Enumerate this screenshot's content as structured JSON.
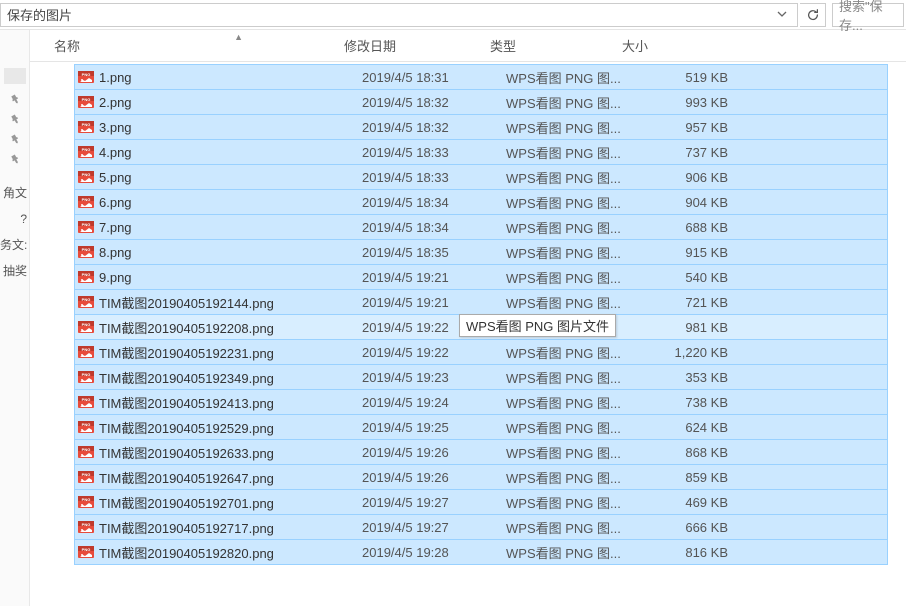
{
  "toolbar": {
    "path": "保存的图片",
    "search_placeholder": "搜索\"保存..."
  },
  "sidebar": {
    "items": [
      "角文",
      "?",
      "务文:",
      "抽奖"
    ]
  },
  "columns": {
    "name": "名称",
    "date": "修改日期",
    "type": "类型",
    "size": "大小"
  },
  "tooltip": "WPS看图 PNG 图片文件",
  "type_truncated": "WPS看图 PNG 图...",
  "files": [
    {
      "name": "1.png",
      "date": "2019/4/5 18:31",
      "size": "519 KB"
    },
    {
      "name": "2.png",
      "date": "2019/4/5 18:32",
      "size": "993 KB"
    },
    {
      "name": "3.png",
      "date": "2019/4/5 18:32",
      "size": "957 KB"
    },
    {
      "name": "4.png",
      "date": "2019/4/5 18:33",
      "size": "737 KB"
    },
    {
      "name": "5.png",
      "date": "2019/4/5 18:33",
      "size": "906 KB"
    },
    {
      "name": "6.png",
      "date": "2019/4/5 18:34",
      "size": "904 KB"
    },
    {
      "name": "7.png",
      "date": "2019/4/5 18:34",
      "size": "688 KB"
    },
    {
      "name": "8.png",
      "date": "2019/4/5 18:35",
      "size": "915 KB"
    },
    {
      "name": "9.png",
      "date": "2019/4/5 19:21",
      "size": "540 KB"
    },
    {
      "name": "TIM截图20190405192144.png",
      "date": "2019/4/5 19:21",
      "size": "721 KB"
    },
    {
      "name": "TIM截图20190405192208.png",
      "date": "2019/4/5 19:22",
      "size": "981 KB",
      "hover": true
    },
    {
      "name": "TIM截图20190405192231.png",
      "date": "2019/4/5 19:22",
      "size": "1,220 KB"
    },
    {
      "name": "TIM截图20190405192349.png",
      "date": "2019/4/5 19:23",
      "size": "353 KB"
    },
    {
      "name": "TIM截图20190405192413.png",
      "date": "2019/4/5 19:24",
      "size": "738 KB"
    },
    {
      "name": "TIM截图20190405192529.png",
      "date": "2019/4/5 19:25",
      "size": "624 KB"
    },
    {
      "name": "TIM截图20190405192633.png",
      "date": "2019/4/5 19:26",
      "size": "868 KB"
    },
    {
      "name": "TIM截图20190405192647.png",
      "date": "2019/4/5 19:26",
      "size": "859 KB"
    },
    {
      "name": "TIM截图20190405192701.png",
      "date": "2019/4/5 19:27",
      "size": "469 KB"
    },
    {
      "name": "TIM截图20190405192717.png",
      "date": "2019/4/5 19:27",
      "size": "666 KB"
    },
    {
      "name": "TIM截图20190405192820.png",
      "date": "2019/4/5 19:28",
      "size": "816 KB"
    }
  ]
}
